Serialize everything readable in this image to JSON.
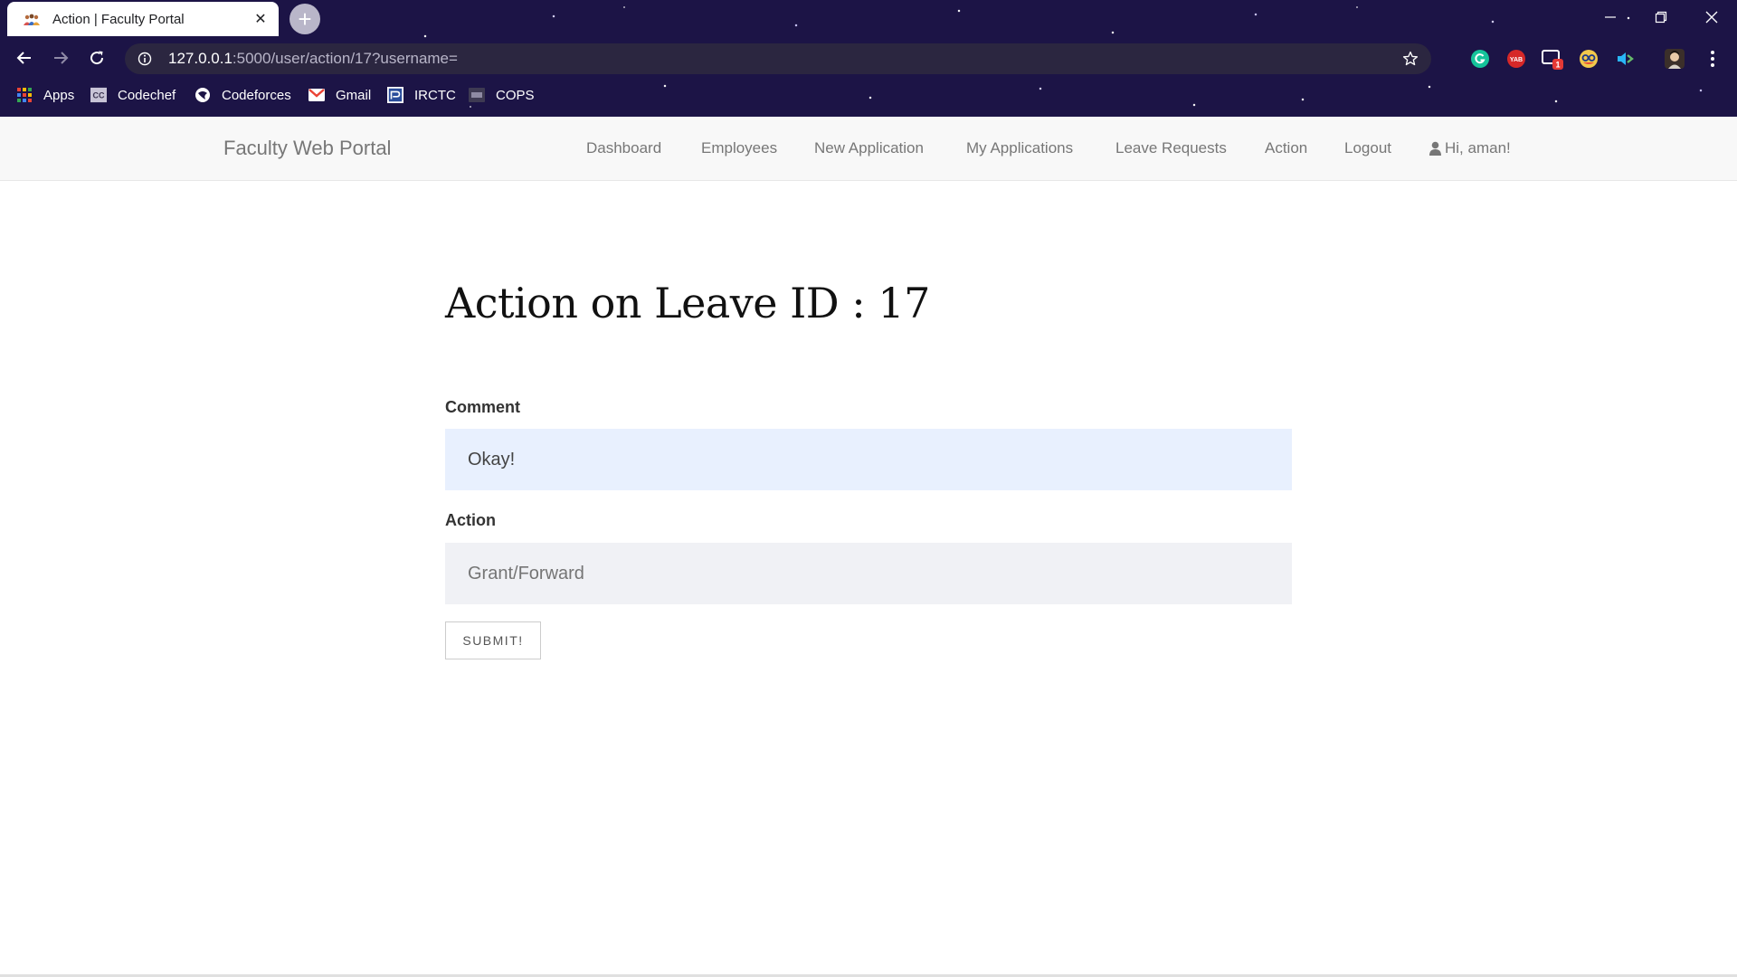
{
  "browser": {
    "tab_title": "Action | Faculty Portal",
    "tab_close": "✕",
    "new_tab": "+",
    "url_host": "127.0.0.1",
    "url_path": ":5000/user/action/17?username=",
    "extension_badge": "1",
    "extension_yab_label": "YAB",
    "bookmarks": [
      {
        "label": "Apps",
        "icon": "apps-grid-icon"
      },
      {
        "label": "Codechef",
        "icon": "codechef-icon"
      },
      {
        "label": "Codeforces",
        "icon": "codeforces-icon"
      },
      {
        "label": "Gmail",
        "icon": "gmail-icon"
      },
      {
        "label": "IRCTC",
        "icon": "irctc-icon"
      },
      {
        "label": "COPS",
        "icon": "cops-icon"
      }
    ]
  },
  "navbar": {
    "brand": "Faculty Web Portal",
    "links": [
      {
        "label": "Dashboard"
      },
      {
        "label": "Employees"
      },
      {
        "label": "New Application"
      },
      {
        "label": "My Applications"
      },
      {
        "label": "Leave Requests"
      },
      {
        "label": "Action"
      },
      {
        "label": "Logout"
      }
    ],
    "user_greeting": "Hi, aman!"
  },
  "form": {
    "title": "Action on Leave ID : 17",
    "comment_label": "Comment",
    "comment_value": "Okay!",
    "action_label": "Action",
    "action_placeholder": "Grant/Forward",
    "submit_label": "SUBMIT!"
  },
  "colors": {
    "chrome_bg": "#1c1446",
    "navbar_bg": "#f8f8f8",
    "comment_field_bg": "#e8f0fe",
    "action_field_bg": "#f0f1f5"
  }
}
